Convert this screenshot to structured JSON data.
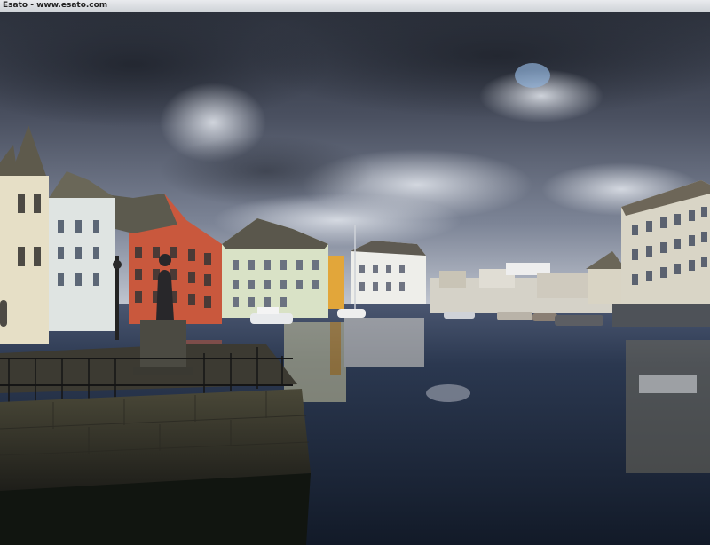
{
  "caption": {
    "text": "Esato - www.esato.com"
  },
  "photo": {
    "kind": "photograph",
    "colors": {
      "sky_dark": "#3a3f4c",
      "sky_mid": "#6c7384",
      "sky_light": "#c4cad4",
      "water": "#1e2a3d",
      "stone_wall": "#3b3a31",
      "house_cream": "#e6dfc6",
      "house_red": "#c9583d",
      "house_green": "#d7e2c3",
      "house_yellow": "#e2a63a",
      "house_white": "#eeeeea",
      "roof": "#5a574c"
    }
  }
}
